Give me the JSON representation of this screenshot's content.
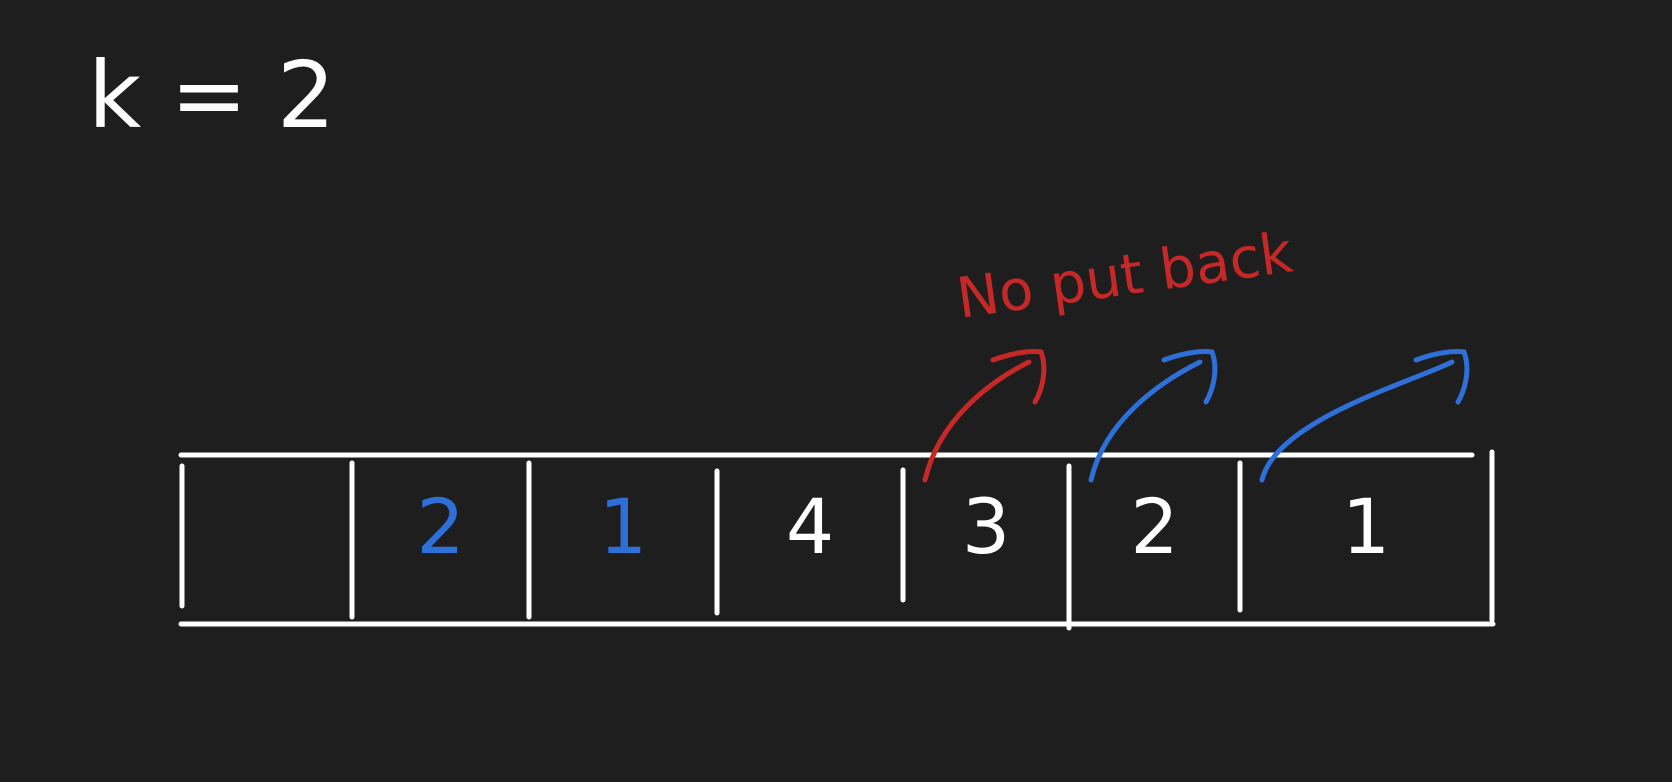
{
  "header": {
    "text": "k = 2"
  },
  "annotation": {
    "text": "No put back",
    "color": "#c62828"
  },
  "colors": {
    "background": "#1e1e1e",
    "ink": "#ffffff",
    "blue": "#2f6fd8",
    "red": "#c62828"
  },
  "cells": [
    {
      "value": "",
      "color": "white"
    },
    {
      "value": "2",
      "color": "blue"
    },
    {
      "value": "1",
      "color": "blue"
    },
    {
      "value": "4",
      "color": "white"
    },
    {
      "value": "3",
      "color": "white"
    },
    {
      "value": "2",
      "color": "white"
    },
    {
      "value": "1",
      "color": "white"
    }
  ],
  "arrows": [
    {
      "from_cell": 4,
      "color": "red"
    },
    {
      "from_cell": 5,
      "color": "blue"
    },
    {
      "from_cell": 6,
      "color": "blue"
    }
  ]
}
